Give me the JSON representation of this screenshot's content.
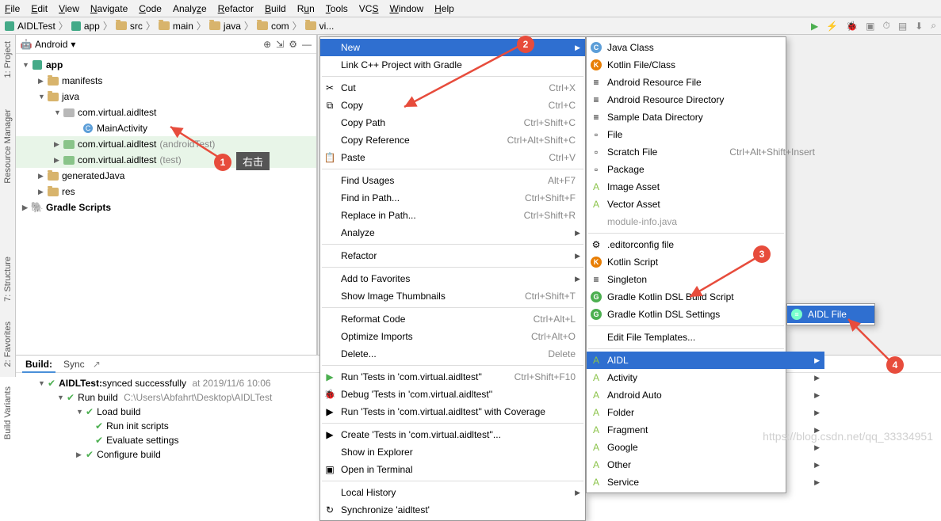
{
  "menubar": [
    "File",
    "Edit",
    "View",
    "Navigate",
    "Code",
    "Analyze",
    "Refactor",
    "Build",
    "Run",
    "Tools",
    "VCS",
    "Window",
    "Help"
  ],
  "breadcrumb": [
    "AIDLTest",
    "app",
    "src",
    "main",
    "java",
    "com",
    "vi..."
  ],
  "project_pane": {
    "title": "Android"
  },
  "tree": {
    "app": "app",
    "manifests": "manifests",
    "java": "java",
    "pkg1": "com.virtual.aidltest",
    "main_activity": "MainActivity",
    "pkg2": "com.virtual.aidltest",
    "pkg2_suffix": "(androidTest)",
    "pkg3": "com.virtual.aidltest",
    "pkg3_suffix": "(test)",
    "generated": "generatedJava",
    "res": "res",
    "gradle": "Gradle Scripts"
  },
  "side_tabs": [
    "1: Project",
    "Resource Manager",
    "7: Structure",
    "2: Favorites",
    "Build Variants"
  ],
  "tooltip": "右击",
  "context_menu": [
    {
      "label": "New",
      "sel": true,
      "arrow": true
    },
    {
      "label": "Link C++ Project with Gradle"
    },
    {
      "sep": true
    },
    {
      "label": "Cut",
      "sc": "Ctrl+X",
      "icon": "✂"
    },
    {
      "label": "Copy",
      "sc": "Ctrl+C",
      "icon": "⧉"
    },
    {
      "label": "Copy Path",
      "sc": "Ctrl+Shift+C"
    },
    {
      "label": "Copy Reference",
      "sc": "Ctrl+Alt+Shift+C"
    },
    {
      "label": "Paste",
      "sc": "Ctrl+V",
      "icon": "📋"
    },
    {
      "sep": true
    },
    {
      "label": "Find Usages",
      "sc": "Alt+F7"
    },
    {
      "label": "Find in Path...",
      "sc": "Ctrl+Shift+F"
    },
    {
      "label": "Replace in Path...",
      "sc": "Ctrl+Shift+R"
    },
    {
      "label": "Analyze",
      "arrow": true
    },
    {
      "sep": true
    },
    {
      "label": "Refactor",
      "arrow": true
    },
    {
      "sep": true
    },
    {
      "label": "Add to Favorites",
      "arrow": true
    },
    {
      "label": "Show Image Thumbnails",
      "sc": "Ctrl+Shift+T"
    },
    {
      "sep": true
    },
    {
      "label": "Reformat Code",
      "sc": "Ctrl+Alt+L"
    },
    {
      "label": "Optimize Imports",
      "sc": "Ctrl+Alt+O"
    },
    {
      "label": "Delete...",
      "sc": "Delete"
    },
    {
      "sep": true
    },
    {
      "label": "Run 'Tests in 'com.virtual.aidltest''",
      "sc": "Ctrl+Shift+F10",
      "icon": "▶",
      "iconColor": "#4caf50"
    },
    {
      "label": "Debug 'Tests in 'com.virtual.aidltest''",
      "icon": "🐞"
    },
    {
      "label": "Run 'Tests in 'com.virtual.aidltest'' with Coverage",
      "icon": "▶"
    },
    {
      "sep": true
    },
    {
      "label": "Create 'Tests in 'com.virtual.aidltest''...",
      "icon": "▶"
    },
    {
      "label": "Show in Explorer"
    },
    {
      "label": "Open in Terminal",
      "icon": "▣"
    },
    {
      "sep": true
    },
    {
      "label": "Local History",
      "arrow": true
    },
    {
      "label": "Synchronize 'aidltest'",
      "icon": "↻"
    }
  ],
  "new_menu": [
    {
      "label": "Java Class",
      "icon": "C",
      "iconBg": "#5c9ed8"
    },
    {
      "label": "Kotlin File/Class",
      "icon": "K",
      "iconBg": "#e87e04"
    },
    {
      "label": "Android Resource File",
      "icon": "≡"
    },
    {
      "label": "Android Resource Directory",
      "icon": "≡"
    },
    {
      "label": "Sample Data Directory",
      "icon": "≡"
    },
    {
      "label": "File",
      "icon": "▫"
    },
    {
      "label": "Scratch File",
      "sc": "Ctrl+Alt+Shift+Insert",
      "icon": "▫"
    },
    {
      "label": "Package",
      "icon": "▫"
    },
    {
      "label": "Image Asset",
      "icon": "A",
      "iconColor": "#8bc34a"
    },
    {
      "label": "Vector Asset",
      "icon": "A",
      "iconColor": "#8bc34a"
    },
    {
      "label": "module-info.java",
      "muted": true
    },
    {
      "sep": true
    },
    {
      "label": ".editorconfig file",
      "icon": "⚙"
    },
    {
      "label": "Kotlin Script",
      "icon": "K",
      "iconBg": "#e87e04"
    },
    {
      "label": "Singleton",
      "icon": "≡"
    },
    {
      "label": "Gradle Kotlin DSL Build Script",
      "icon": "G",
      "iconBg": "#4caf50"
    },
    {
      "label": "Gradle Kotlin DSL Settings",
      "icon": "G",
      "iconBg": "#4caf50"
    },
    {
      "sep": true
    },
    {
      "label": "Edit File Templates..."
    },
    {
      "sep": true
    },
    {
      "label": "AIDL",
      "sel": true,
      "arrow": true,
      "icon": "A",
      "iconColor": "#8bc34a"
    },
    {
      "label": "Activity",
      "arrow": true,
      "icon": "A",
      "iconColor": "#8bc34a"
    },
    {
      "label": "Android Auto",
      "arrow": true,
      "icon": "A",
      "iconColor": "#8bc34a"
    },
    {
      "label": "Folder",
      "arrow": true,
      "icon": "A",
      "iconColor": "#8bc34a"
    },
    {
      "label": "Fragment",
      "arrow": true,
      "icon": "A",
      "iconColor": "#8bc34a"
    },
    {
      "label": "Google",
      "arrow": true,
      "icon": "A",
      "iconColor": "#8bc34a"
    },
    {
      "label": "Other",
      "arrow": true,
      "icon": "A",
      "iconColor": "#8bc34a"
    },
    {
      "label": "Service",
      "arrow": true,
      "icon": "A",
      "iconColor": "#8bc34a"
    }
  ],
  "aidl_menu": [
    {
      "label": "AIDL File",
      "sel": true,
      "icon": "≡",
      "iconBg": "#7fc"
    }
  ],
  "build": {
    "tab1": "Build:",
    "tab2": "Sync",
    "row1_a": "AIDLTest:",
    "row1_b": " synced successfully",
    "row1_time": "at 2019/11/6 10:06",
    "row2": "Run build",
    "row2_path": "C:\\Users\\Abfahrt\\Desktop\\AIDLTest",
    "row3": "Load build",
    "row4": "Run init scripts",
    "row5": "Evaluate settings",
    "row6": "Configure build"
  },
  "watermark": "https://blog.csdn.net/qq_33334951"
}
